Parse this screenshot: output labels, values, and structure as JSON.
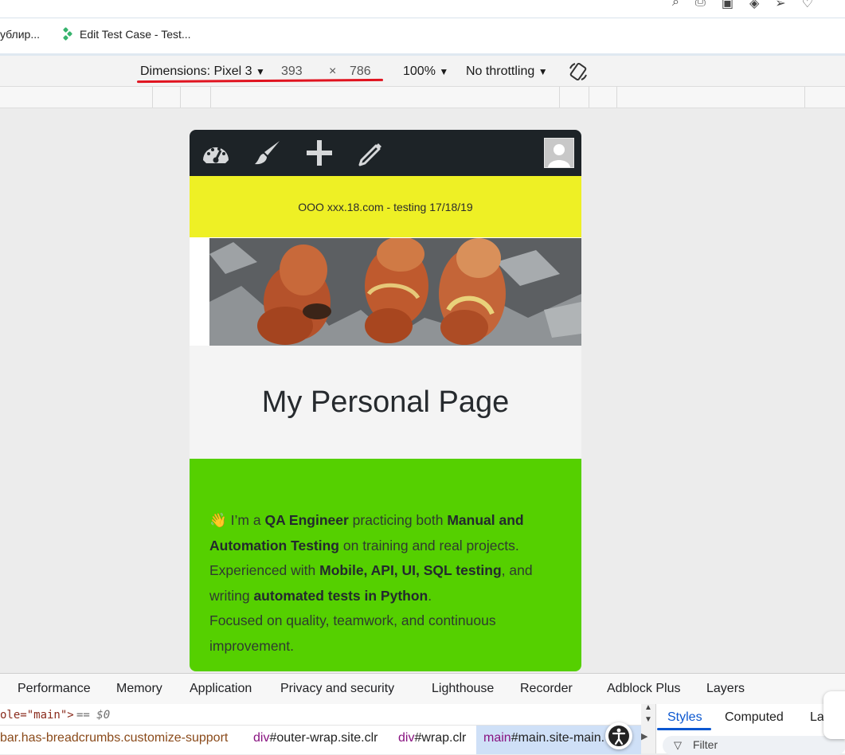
{
  "browser": {
    "bookmarks": [
      {
        "label": "ублир..."
      },
      {
        "label": "Edit Test Case - Test..."
      }
    ]
  },
  "device_toolbar": {
    "device_label": "Dimensions: Pixel 3",
    "width": "393",
    "times": "×",
    "height": "786",
    "zoom": "100%",
    "throttling": "No throttling"
  },
  "site": {
    "banner_text": "OOO xxx.18.com - testing 17/18/19",
    "page_title": "My Personal Page",
    "bio": {
      "wave": "👋",
      "p1_a": " I’m a ",
      "p1_b": "QA Engineer",
      "p1_c": " practicing both ",
      "p1_d": "Manual and Automation Testing",
      "p1_e": " on training and real projects.",
      "p2_a": "Experienced with ",
      "p2_b": "Mobile, API, UI, SQL testing",
      "p2_c": ", and writing ",
      "p2_d": "automated tests in Python",
      "p2_e": ".",
      "p3": "Focused on quality, teamwork, and continuous improvement."
    }
  },
  "devtools": {
    "tabs": [
      "Performance",
      "Memory",
      "Application",
      "Privacy and security",
      "Lighthouse",
      "Recorder",
      "Adblock Plus",
      "Layers"
    ],
    "code_line_a": "ole=\"main\">",
    "code_line_b": " == $0",
    "breadcrumbs": [
      {
        "tag": "",
        "rest": "bar.has-breadcrumbs.customize-support"
      },
      {
        "tag": "div",
        "rest": "#outer-wrap.site.clr"
      },
      {
        "tag": "div",
        "rest": "#wrap.clr"
      },
      {
        "tag": "main",
        "rest": "#main.site-main."
      }
    ],
    "side_tabs": [
      "Styles",
      "Computed",
      "La"
    ],
    "filter_placeholder": "Filter"
  },
  "colors": {
    "banner": "#eef025",
    "bio_background": "#55d000",
    "wp_toolbar": "#1d2327",
    "underline": "#e0131f"
  }
}
